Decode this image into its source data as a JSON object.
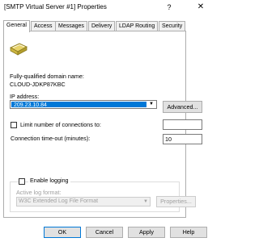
{
  "window": {
    "title": "[SMTP Virtual Server #1] Properties",
    "help_glyph": "?",
    "close_glyph": "✕"
  },
  "tabs": [
    {
      "label": "General",
      "active": true
    },
    {
      "label": "Access",
      "active": false
    },
    {
      "label": "Messages",
      "active": false
    },
    {
      "label": "Delivery",
      "active": false
    },
    {
      "label": "LDAP Routing",
      "active": false
    },
    {
      "label": "Security",
      "active": false
    }
  ],
  "general": {
    "icon": "smtp-server-icon",
    "fqdn_label": "Fully-qualified domain name:",
    "fqdn_value": "CLOUD-JDKP87KBC",
    "ip_label": "IP address:",
    "ip_value": "209.23.10.84",
    "advanced_button": "Advanced...",
    "limit_connections_label": "Limit number of connections to:",
    "limit_connections_checked": false,
    "limit_connections_value": "",
    "timeout_label": "Connection time-out (minutes):",
    "timeout_value": "10",
    "enable_logging_label": "Enable logging",
    "enable_logging_checked": false,
    "log_format_label": "Active log format:",
    "log_format_value": "W3C Extended Log File Format",
    "properties_button": "Properties..."
  },
  "footer": {
    "ok": "OK",
    "cancel": "Cancel",
    "apply": "Apply",
    "help": "Help"
  },
  "colors": {
    "selection": "#0078d7",
    "disabled_text": "#a0a0a0"
  }
}
